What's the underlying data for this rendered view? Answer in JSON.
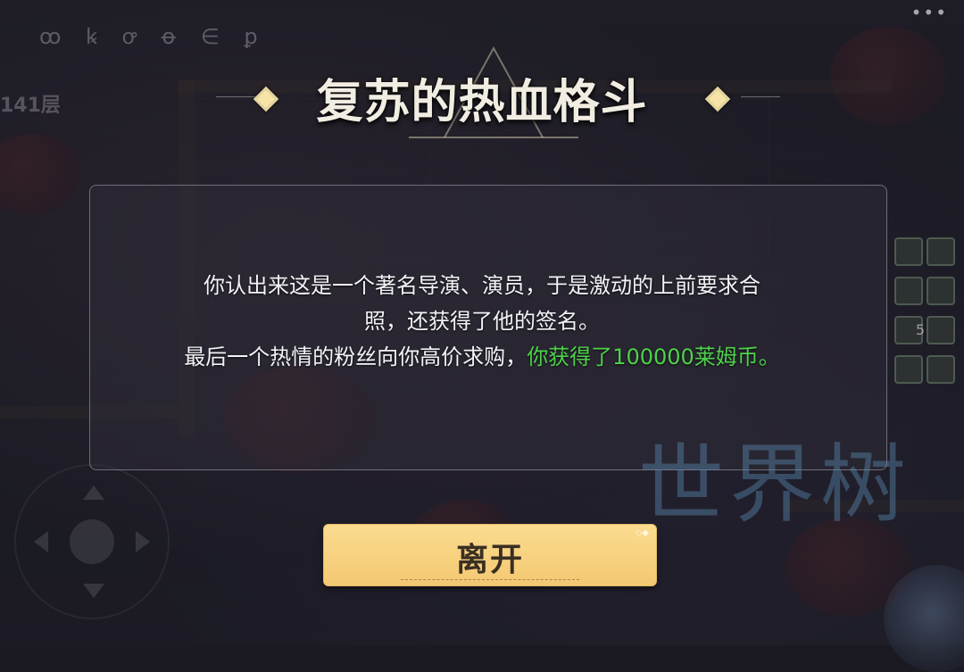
{
  "hud": {
    "top_symbols": "ꝏ ꝃ ꝍ ꝋ ∈ ꝑ",
    "floor": "141层",
    "menu_dots": "•••",
    "item_count": "5"
  },
  "dialog": {
    "title": "复苏的热血格斗",
    "line1": "你认出来这是一个著名导演、演员，于是激动的上前要求合",
    "line2": "照，还获得了他的签名。",
    "line3_prefix": "最后一个热情的粉丝向你高价求购，",
    "line3_reward": "你获得了100000莱姆币。"
  },
  "buttons": {
    "leave": "离开"
  },
  "watermark": "世界树",
  "colors": {
    "reward_text": "#4dd24a",
    "button_bg": "#f7d27f",
    "title": "#f2ede2"
  }
}
